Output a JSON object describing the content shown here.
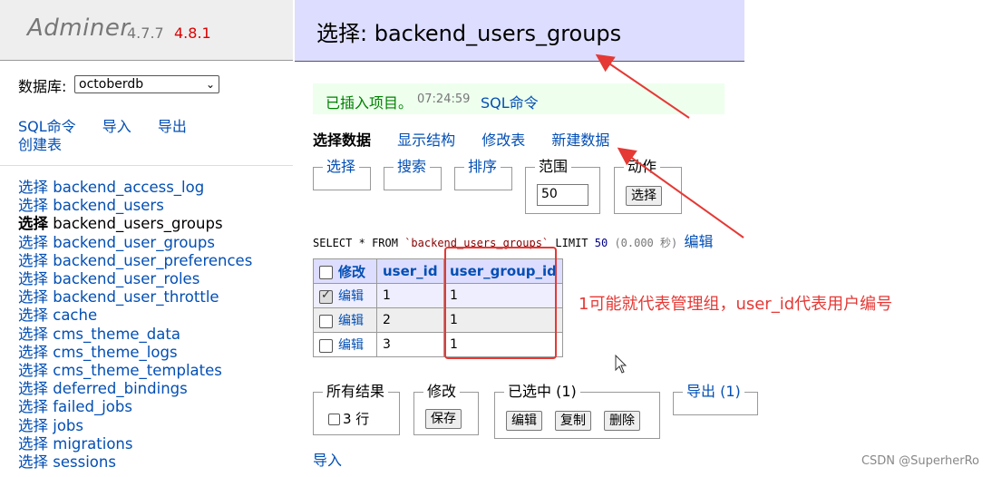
{
  "brand": {
    "name": "Adminer",
    "version": "4.7.7",
    "new_version": "4.8.1"
  },
  "database": {
    "label": "数据库:",
    "selected": "octoberdb"
  },
  "side_links": [
    "SQL命令",
    "导入",
    "导出",
    "创建表"
  ],
  "tables": [
    {
      "label": "选择",
      "name": "backend_access_log"
    },
    {
      "label": "选择",
      "name": "backend_users"
    },
    {
      "label": "选择",
      "name": "backend_users_groups"
    },
    {
      "label": "选择",
      "name": "backend_user_groups"
    },
    {
      "label": "选择",
      "name": "backend_user_preferences"
    },
    {
      "label": "选择",
      "name": "backend_user_roles"
    },
    {
      "label": "选择",
      "name": "backend_user_throttle"
    },
    {
      "label": "选择",
      "name": "cache"
    },
    {
      "label": "选择",
      "name": "cms_theme_data"
    },
    {
      "label": "选择",
      "name": "cms_theme_logs"
    },
    {
      "label": "选择",
      "name": "cms_theme_templates"
    },
    {
      "label": "选择",
      "name": "deferred_bindings"
    },
    {
      "label": "选择",
      "name": "failed_jobs"
    },
    {
      "label": "选择",
      "name": "jobs"
    },
    {
      "label": "选择",
      "name": "migrations"
    },
    {
      "label": "选择",
      "name": "sessions"
    }
  ],
  "header": {
    "title": "选择: backend_users_groups"
  },
  "message": {
    "text": "已插入项目。",
    "time": "07:24:59",
    "link": "SQL命令"
  },
  "tabs": [
    "选择数据",
    "显示结构",
    "修改表",
    "新建数据"
  ],
  "filters": {
    "select": "选择",
    "search": "搜索",
    "sort": "排序",
    "limit_label": "范围",
    "limit_value": "50",
    "action_label": "动作",
    "action_button": "选择"
  },
  "sql": {
    "select": "SELECT",
    "star": "*",
    "from": "FROM",
    "table": "`backend_users_groups`",
    "limit": "LIMIT",
    "limit_num": "50",
    "time": "(0.000 秒)",
    "edit": "编辑"
  },
  "grid": {
    "headers": [
      "修改",
      "user_id",
      "user_group_id"
    ],
    "rows": [
      {
        "edit": "编辑",
        "user_id": "1",
        "user_group_id": "1",
        "checked": true
      },
      {
        "edit": "编辑",
        "user_id": "2",
        "user_group_id": "1",
        "checked": false
      },
      {
        "edit": "编辑",
        "user_id": "3",
        "user_group_id": "1",
        "checked": false
      }
    ]
  },
  "annotation": "1可能就代表管理组，user_id代表用户编号",
  "bottom": {
    "all_results": "所有结果",
    "rows_count": "3 行",
    "modify": "修改",
    "save": "保存",
    "selected": "已选中 (1)",
    "edit": "编辑",
    "copy": "复制",
    "delete": "删除",
    "export": "导出 (1)",
    "import": "导入"
  },
  "watermark": "CSDN @SuperherRo",
  "colors": {
    "annotation_red": "#e53935",
    "link_blue": "#034fb4",
    "header_bg": "#ddddff"
  }
}
